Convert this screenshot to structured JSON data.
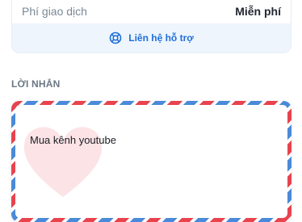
{
  "fee": {
    "label": "Phí giao dịch",
    "value": "Miễn phí"
  },
  "support": {
    "label": "Liên hệ hỗ trợ",
    "icon": "lifebuoy-icon",
    "color": "#1e6fd9"
  },
  "message_section": {
    "title": "LỜI NHẮN",
    "message": "Mua kênh youtube",
    "envelope_colors": {
      "red": "#e8434f",
      "blue": "#4a8ad9"
    },
    "heart_color": "#fbe3e6"
  }
}
